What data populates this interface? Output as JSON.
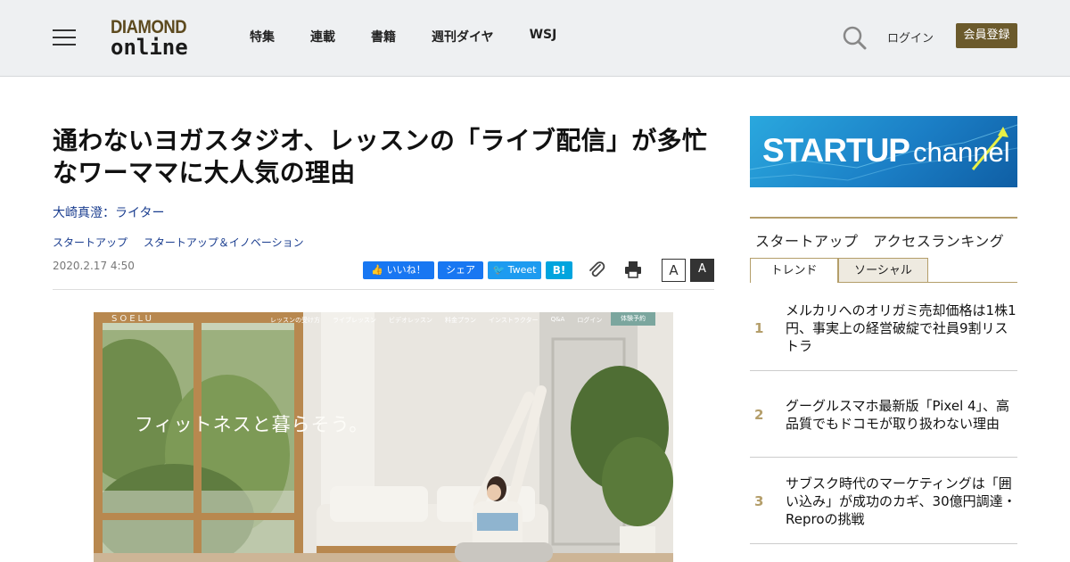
{
  "header": {
    "logo_top": "DIAMOND",
    "logo_bottom": "online",
    "nav": [
      "特集",
      "連載",
      "書籍",
      "週刊ダイヤ",
      "WSJ"
    ],
    "login": "ログイン",
    "register": "会員登録"
  },
  "article": {
    "title": "通わないヨガスタジオ、レッスンの「ライブ配信」が多忙なワーママに大人気の理由",
    "author": "大崎真澄：ライター",
    "tags": [
      "スタートアップ",
      "スタートアップ＆イノベーション"
    ],
    "date": "2020.2.17 4:50",
    "share": {
      "like": "いいね！",
      "share": "シェア",
      "tweet": "Tweet",
      "hatena": "B!"
    },
    "font_normal": "A",
    "font_large": "A"
  },
  "hero": {
    "brand": "SOELU",
    "nav_items": [
      "レッスンの受け方",
      "ライブレッスン",
      "ビデオレッスン",
      "料金プラン",
      "インストラクター",
      "Q&A",
      "ログイン"
    ],
    "reserve": "体験予約",
    "copy": "フィットネスと暮らそう。"
  },
  "sidebar": {
    "banner_bold": "STARTUP",
    "banner_light": "channel",
    "ranking_title": "スタートアップ　アクセスランキング",
    "tabs": [
      "トレンド",
      "ソーシャル"
    ],
    "items": [
      {
        "rank": "1",
        "title": "メルカリへのオリガミ売却価格は1株1円、事実上の経営破綻で社員9割リストラ"
      },
      {
        "rank": "2",
        "title": "グーグルスマホ最新版「Pixel 4」、高品質でもドコモが取り扱わない理由"
      },
      {
        "rank": "3",
        "title": "サブスク時代のマーケティングは「囲い込み」が成功のカギ、30億円調達・Reproの挑戦"
      }
    ]
  },
  "colors": {
    "header_bg": "#eef0f2",
    "brand_gold": "#6b5a2c",
    "link_blue": "#1a3d8f",
    "rank_gold": "#b49e6a"
  }
}
